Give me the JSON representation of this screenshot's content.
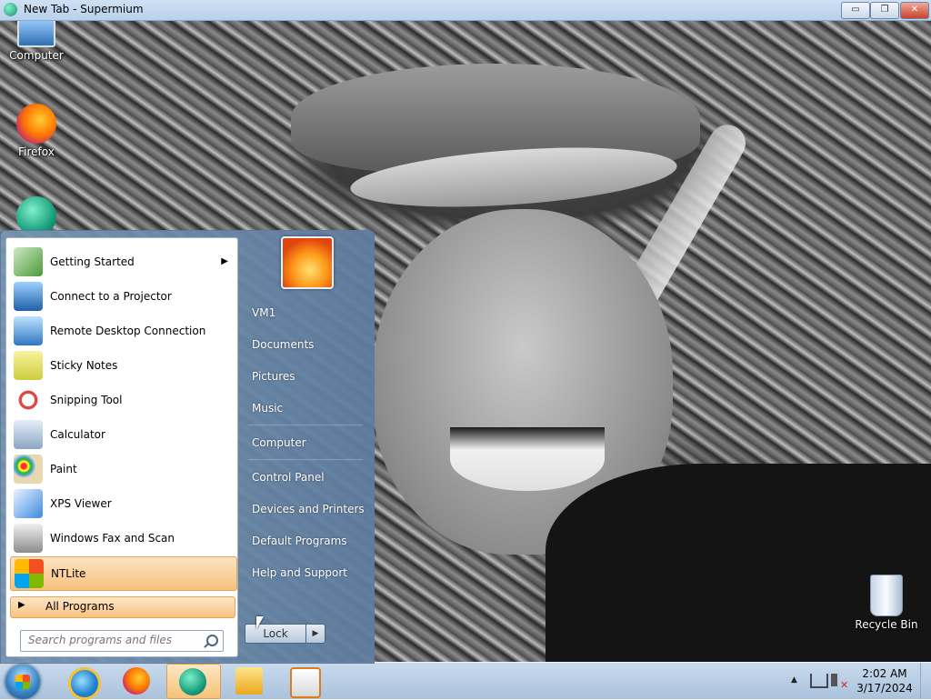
{
  "window": {
    "title": "New Tab - Supermium",
    "buttons": {
      "minimize": "▭",
      "maximize": "❐",
      "close": "✕"
    }
  },
  "desktop_icons": [
    {
      "label": "Computer",
      "icon": "computer-icon"
    },
    {
      "label": "Firefox",
      "icon": "firefox-icon"
    },
    {
      "label": "",
      "icon": "supermium-icon"
    },
    {
      "label": "Recycle Bin",
      "icon": "recycle-bin-icon"
    }
  ],
  "start_menu": {
    "programs": [
      {
        "label": "Getting Started",
        "icon": "getting-started-icon",
        "has_submenu": true
      },
      {
        "label": "Connect to a Projector",
        "icon": "projector-icon"
      },
      {
        "label": "Remote Desktop Connection",
        "icon": "remote-desktop-icon"
      },
      {
        "label": "Sticky Notes",
        "icon": "sticky-notes-icon"
      },
      {
        "label": "Snipping Tool",
        "icon": "snipping-tool-icon"
      },
      {
        "label": "Calculator",
        "icon": "calculator-icon"
      },
      {
        "label": "Paint",
        "icon": "paint-icon"
      },
      {
        "label": "XPS Viewer",
        "icon": "xps-viewer-icon"
      },
      {
        "label": "Windows Fax and Scan",
        "icon": "fax-scan-icon"
      },
      {
        "label": "NTLite",
        "icon": "ntlite-icon",
        "highlighted": true
      }
    ],
    "all_programs": "All Programs",
    "search_placeholder": "Search programs and files",
    "right_links": [
      "VM1",
      "Documents",
      "Pictures",
      "Music",
      "Computer",
      "Control Panel",
      "Devices and Printers",
      "Default Programs",
      "Help and Support"
    ],
    "lock_label": "Lock",
    "lock_arrow": "▶"
  },
  "taskbar": {
    "pinned": [
      "internet-explorer-icon",
      "firefox-icon",
      "supermium-icon",
      "file-explorer-icon",
      "media-player-icon"
    ],
    "active": "supermium-icon",
    "tray_arrow": "▲",
    "tray_volume_mute": "✕",
    "clock_time": "2:02 AM",
    "clock_date": "3/17/2024"
  }
}
